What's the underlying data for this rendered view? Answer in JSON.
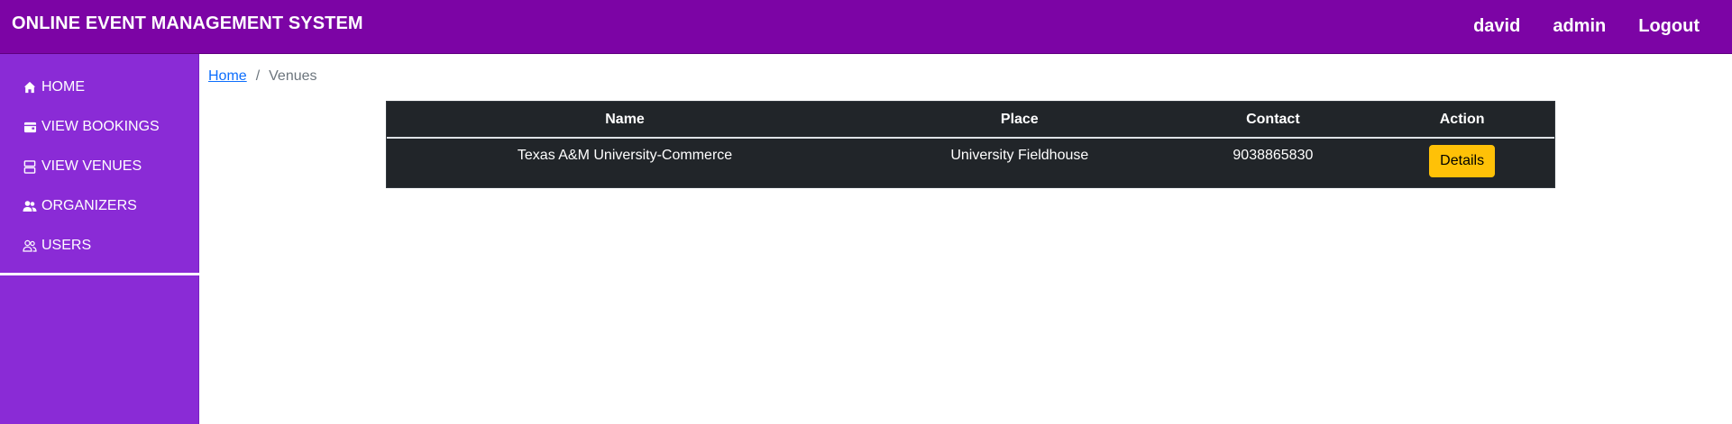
{
  "header": {
    "title": "ONLINE EVENT MANAGEMENT SYSTEM",
    "nav": {
      "user": "david",
      "role": "admin",
      "logout": "Logout"
    }
  },
  "sidebar": {
    "items": [
      {
        "label": "HOME",
        "icon": "home-icon"
      },
      {
        "label": "VIEW BOOKINGS",
        "icon": "wallet-icon"
      },
      {
        "label": "VIEW VENUES",
        "icon": "server-icon"
      },
      {
        "label": "ORGANIZERS",
        "icon": "people-fill-icon"
      },
      {
        "label": "USERS",
        "icon": "people-outline-icon"
      }
    ]
  },
  "breadcrumb": {
    "home": "Home",
    "separator": "/",
    "current": "Venues"
  },
  "table": {
    "columns": [
      "Name",
      "Place",
      "Contact",
      "Action"
    ],
    "rows": [
      {
        "name": "Texas A&M University-Commerce",
        "place": "University Fieldhouse",
        "contact": "9038865830",
        "action": "Details"
      }
    ]
  },
  "colors": {
    "header_bg": "#7c04a5",
    "sidebar_bg": "#8a2bd6",
    "table_bg": "#212529",
    "button_bg": "#ffc107"
  }
}
